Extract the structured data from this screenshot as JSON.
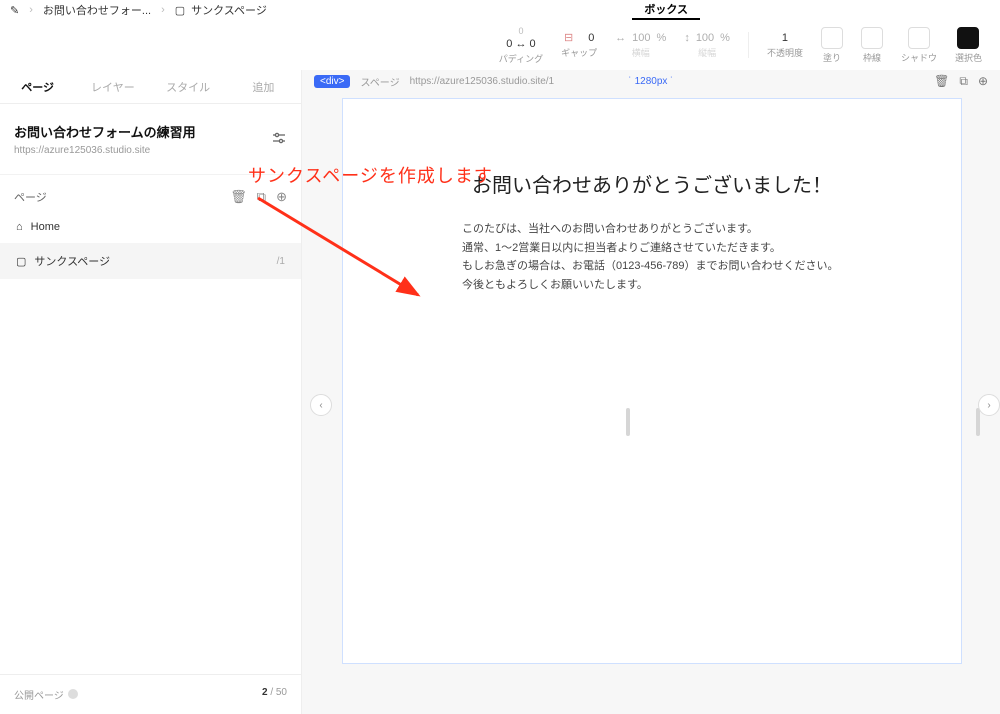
{
  "breadcrumb": {
    "project": "お問い合わせフォー...",
    "page": "サンクスページ"
  },
  "top_tab": "ボックス",
  "props": {
    "padding": {
      "val": "0 ↔ 0",
      "sub": "0",
      "label": "パディング"
    },
    "gap": {
      "val": "0",
      "label": "ギャップ"
    },
    "width": {
      "val": "100",
      "unit": "%",
      "label": "横幅"
    },
    "height": {
      "val": "100",
      "unit": "%",
      "label": "縦幅"
    },
    "opacity": {
      "val": "1",
      "label": "不透明度"
    },
    "fill": {
      "label": "塗り"
    },
    "border": {
      "label": "枠線"
    },
    "shadow": {
      "label": "シャドウ"
    },
    "selcolor": {
      "label": "選択色"
    }
  },
  "sidetabs": {
    "page": "ページ",
    "layer": "レイヤー",
    "style": "スタイル",
    "add": "追加"
  },
  "project": {
    "title": "お問い合わせフォームの練習用",
    "url": "https://azure125036.studio.site"
  },
  "pages": {
    "heading": "ページ",
    "items": [
      {
        "icon": "⌂",
        "label": "Home",
        "slug": ""
      },
      {
        "icon": "▢",
        "label": "サンクスページ",
        "slug": "/1"
      }
    ]
  },
  "footer": {
    "label": "公開ページ",
    "count": "2",
    "total": "/ 50"
  },
  "canvas": {
    "tag": "<div>",
    "name": "スページ",
    "url": "https://azure125036.studio.site/1",
    "ruler": "1280px"
  },
  "content": {
    "heading": "お問い合わせありがとうございました！",
    "body": "このたびは、当社へのお問い合わせありがとうございます。\n通常、1〜2営業日以内に担当者よりご連絡させていただきます。\nもしお急ぎの場合は、お電話（0123-456-789）までお問い合わせください。\n今後ともよろしくお願いいたします。"
  },
  "annotation": "サンクスページを作成します"
}
